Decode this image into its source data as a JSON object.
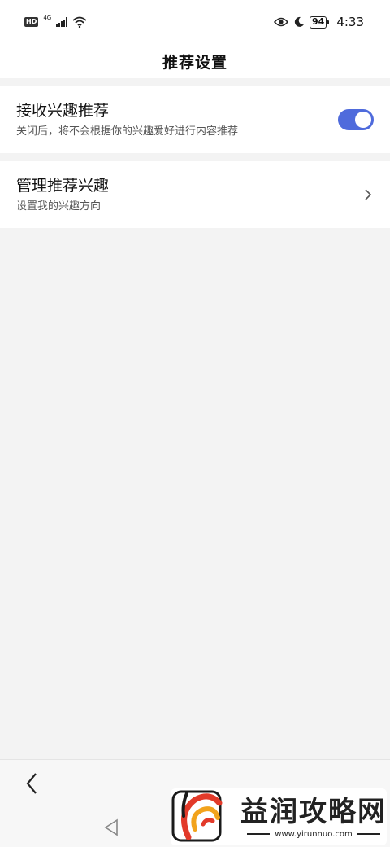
{
  "status_bar": {
    "hd": "HD",
    "network": "4G",
    "battery": "94",
    "time": "4:33",
    "icons": [
      "hd-icon",
      "signal-icon",
      "wifi-icon",
      "eye-icon",
      "moon-icon",
      "battery-icon"
    ]
  },
  "header": {
    "title": "推荐设置"
  },
  "settings": {
    "interest_recommend": {
      "title": "接收兴趣推荐",
      "subtitle": "关闭后，将不会根据你的兴趣爱好进行内容推荐",
      "enabled": true
    },
    "manage_interests": {
      "title": "管理推荐兴趣",
      "subtitle": "设置我的兴趣方向"
    }
  },
  "watermark": {
    "name": "益润攻略网",
    "url": "www.yirunnuo.com"
  },
  "colors": {
    "accent": "#4f6bdc",
    "background": "#f3f3f3",
    "surface": "#ffffff"
  }
}
